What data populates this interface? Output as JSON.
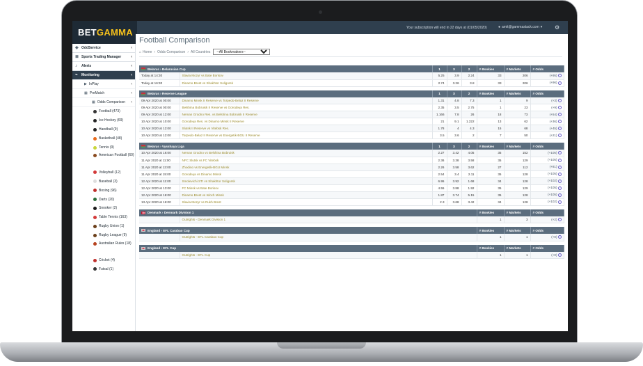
{
  "brand": {
    "part1": "BET",
    "part2": "GAMMA",
    "accent": "#f7c21b",
    "header_bg": "#2f3f4e"
  },
  "topbar": {
    "subscription": "Your subscription will end in 22 days at (01/05/2020)",
    "user": "amit@gammastack.com"
  },
  "sidebar": {
    "items": [
      {
        "label": "OddService",
        "icon": "gamepad-icon",
        "active": false
      },
      {
        "label": "Sports Trading Manager",
        "icon": "list-icon",
        "active": false
      },
      {
        "label": "Alerts",
        "icon": "bell-icon",
        "active": false
      },
      {
        "label": "Monitoring",
        "icon": "chart-icon",
        "active": true
      }
    ],
    "inplay": "InPlay",
    "prematch": "PreMatch",
    "odds_comparison": "Odds Comparison",
    "sports": [
      {
        "label": "Football (473)",
        "color": "#333333"
      },
      {
        "label": "Ice Hockey (69)",
        "color": "#222222"
      },
      {
        "label": "Handball (9)",
        "color": "#222222"
      },
      {
        "label": "Basketball (48)",
        "color": "#e86a1c"
      },
      {
        "label": "Tennis (9)",
        "color": "#c9d63a"
      },
      {
        "label": "American Football (60)",
        "color": "#8a4b1f"
      },
      {
        "label": "Volleyball (12)",
        "color": "#d33a3a"
      },
      {
        "label": "Baseball (3)",
        "color": "#dddddd"
      },
      {
        "label": "Boxing (96)",
        "color": "#c0302c"
      },
      {
        "label": "Darts (20)",
        "color": "#2a6d3a"
      },
      {
        "label": "Snooker (2)",
        "color": "#1a1a1a"
      },
      {
        "label": "Table Tennis (163)",
        "color": "#d33a3a"
      },
      {
        "label": "Rugby Union (1)",
        "color": "#6b3f1a"
      },
      {
        "label": "Rugby League (9)",
        "color": "#6b3f1a"
      },
      {
        "label": "Australian Rules (18)",
        "color": "#b7431f"
      },
      {
        "label": "Cricket (4)",
        "color": "#c0302c"
      },
      {
        "label": "Futsal (1)",
        "color": "#333333"
      }
    ]
  },
  "page": {
    "title": "Football Comparison",
    "breadcrumb": [
      "Home",
      "Odds Comparison",
      "All Countries"
    ],
    "bookmaker_select": "--All Bookmakers--"
  },
  "headers": {
    "one": "1",
    "x": "X",
    "two": "2",
    "bookies": "# Bookies",
    "markets": "# Markets",
    "odds": "# Odds"
  },
  "leagues": [
    {
      "name": "Belarus › Belarusian Cup",
      "flag": "belarus",
      "type": "match",
      "rows": [
        {
          "time": "Today at 14:30",
          "match": "Slavia Mozyr vs Bate Borisov",
          "one": "5.25",
          "x": "3.9",
          "two": "2.24",
          "bookies": "33",
          "markets": "206",
          "odds": "(+95)"
        },
        {
          "time": "Today at 16:30",
          "match": "Dinamo Brest vs Shakhtor Soligorsk",
          "one": "2.74",
          "x": "3.26",
          "two": "3.8",
          "bookies": "33",
          "markets": "206",
          "odds": "(+96)"
        }
      ]
    },
    {
      "name": "Belarus › Reserve League",
      "flag": "belarus",
      "type": "match",
      "rows": [
        {
          "time": "09 Apr 2020 at 00:00",
          "match": "Dinamo Minsk II Reserve vs Torpedo-Belaz II Reserve",
          "one": "1.31",
          "x": "4.8",
          "two": "7.3",
          "bookies": "1",
          "markets": "9",
          "odds": "(+3)"
        },
        {
          "time": "09 Apr 2020 at 00:00",
          "match": "Belshina Bobruisk II Reserve vs Gorodeya Res.",
          "one": "2.35",
          "x": "3.5",
          "two": "2.75",
          "bookies": "1",
          "markets": "23",
          "odds": "(+9)"
        },
        {
          "time": "09 Apr 2020 at 12:00",
          "match": "Neman Grodno Res. vs Belshina Bobruisk II Reserve",
          "one": "1.166",
          "x": "7.8",
          "two": "26",
          "bookies": "18",
          "markets": "73",
          "odds": "(+54)"
        },
        {
          "time": "10 Apr 2020 at 10:00",
          "match": "Gorodeya Res. vs Dinamo Minsk II Reserve",
          "one": "21",
          "x": "9.1",
          "two": "1.222",
          "bookies": "13",
          "markets": "62",
          "odds": "(+36)"
        },
        {
          "time": "10 Apr 2020 at 12:00",
          "match": "Slutsk II Reserve vs Vitebsk Res.",
          "one": "1.78",
          "x": "4",
          "two": "4.3",
          "bookies": "15",
          "markets": "68",
          "odds": "(+45)"
        },
        {
          "time": "10 Apr 2020 at 12:00",
          "match": "Torpedo-Belaz II Reserve vs Energetik-BGU II Reserve",
          "one": "3.5",
          "x": "3.6",
          "two": "2",
          "bookies": "7",
          "markets": "50",
          "odds": "(+21)"
        }
      ]
    },
    {
      "name": "Belarus › Vysshaya Liga",
      "flag": "belarus",
      "type": "match",
      "rows": [
        {
          "time": "10 Apr 2020 at 16:00",
          "match": "Neman Grodno vs Belshina Bobruisk",
          "one": "2.27",
          "x": "3.42",
          "two": "4.05",
          "bookies": "35",
          "markets": "152",
          "odds": "(+105)"
        },
        {
          "time": "11 Apr 2020 at 11:00",
          "match": "NFC Slutsk vs FC Vitebsk",
          "one": "2.36",
          "x": "3.38",
          "two": "3.58",
          "bookies": "35",
          "markets": "129",
          "odds": "(+105)"
        },
        {
          "time": "11 Apr 2020 at 13:00",
          "match": "Zhodino vs Energetik-BGU Minsk",
          "one": "2.26",
          "x": "3.58",
          "two": "3.62",
          "bookies": "27",
          "markets": "112",
          "odds": "(+81)"
        },
        {
          "time": "11 Apr 2020 at 15:00",
          "match": "Gorodeya vs Dinamo Minsk",
          "one": "2.54",
          "x": "3.4",
          "two": "2.11",
          "bookies": "35",
          "markets": "128",
          "odds": "(+105)"
        },
        {
          "time": "12 Apr 2020 at 11:00",
          "match": "Smolevichi STI vs Shakhtor Soligorsk",
          "one": "6.95",
          "x": "3.92",
          "two": "1.68",
          "bookies": "34",
          "markets": "128",
          "odds": "(+102)"
        },
        {
          "time": "12 Apr 2020 at 13:00",
          "match": "FC Minsk vs Bate Borisov",
          "one": "4.55",
          "x": "3.88",
          "two": "1.92",
          "bookies": "35",
          "markets": "129",
          "odds": "(+105)"
        },
        {
          "time": "12 Apr 2020 at 16:00",
          "match": "Dinamo Brest vs Isloch Minsk",
          "one": "1.87",
          "x": "3.74",
          "two": "5.15",
          "bookies": "35",
          "markets": "128",
          "odds": "(+105)"
        },
        {
          "time": "13 Apr 2020 at 16:00",
          "match": "Slavia Mozyr vs Rukh Brest",
          "one": "2.3",
          "x": "3.68",
          "two": "3.42",
          "bookies": "34",
          "markets": "128",
          "odds": "(+102)"
        }
      ]
    },
    {
      "name": "Denmark › Denmark Division 1",
      "flag": "denmark",
      "type": "outright",
      "rows": [
        {
          "match": "Outrights - Denmark Division 1",
          "bookies": "1",
          "markets": "3",
          "odds": "(+2)"
        }
      ]
    },
    {
      "name": "England › EFL Carabao Cup",
      "flag": "england",
      "type": "outright",
      "rows": [
        {
          "match": "Outrights - EFL Carabao Cup",
          "bookies": "1",
          "markets": "1",
          "odds": "(+0)"
        }
      ]
    },
    {
      "name": "England › EFL Cup",
      "flag": "england",
      "type": "outright",
      "rows": [
        {
          "match": "Outrights - EFL Cup",
          "bookies": "1",
          "markets": "1",
          "odds": "(+0)"
        }
      ]
    }
  ]
}
